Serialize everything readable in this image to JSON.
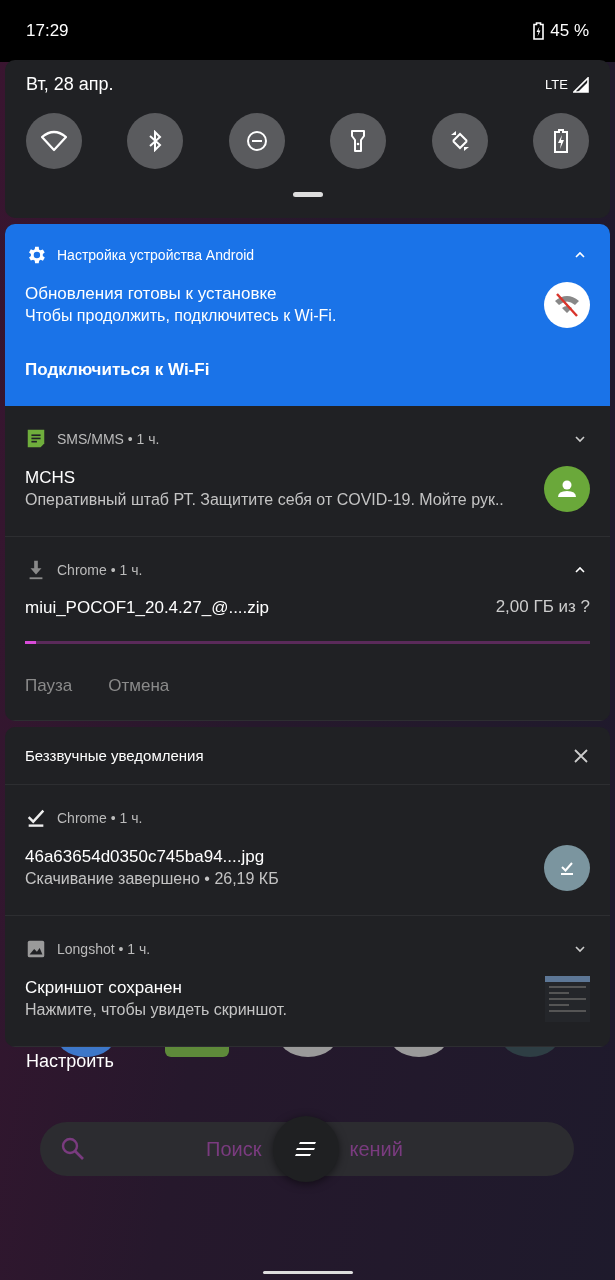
{
  "status_bar": {
    "time": "17:29",
    "battery": "45 %"
  },
  "quick_settings": {
    "date": "Вт, 28 апр.",
    "network": "LTE",
    "tiles": [
      {
        "kind": "wifi"
      },
      {
        "kind": "bluetooth"
      },
      {
        "kind": "dnd"
      },
      {
        "kind": "flashlight"
      },
      {
        "kind": "rotate"
      },
      {
        "kind": "battery_saver"
      }
    ]
  },
  "notifications": [
    {
      "kind": "system",
      "header": "Настройка устройства Android",
      "expanded": true,
      "title": "Обновления готовы к установке",
      "text": "Чтобы продолжить, подключитесь к Wi-Fi.",
      "actions": [
        "Подключиться к Wi-Fi"
      ]
    },
    {
      "kind": "message",
      "header": "SMS/MMS • 1 ч.",
      "expanded": false,
      "title": "MCHS",
      "text": "Оперативный штаб РТ. Защитите себя от COVID-19. Мойте рук.."
    },
    {
      "kind": "download",
      "header": "Chrome • 1 ч.",
      "expanded": true,
      "title": "miui_POCOF1_20.4.27_@....zip",
      "size": "2,00 ГБ из ?",
      "level": 0.02,
      "actions": [
        "Пауза",
        "Отмена"
      ]
    }
  ],
  "silent": {
    "header": "Беззвучные уведомления",
    "items": [
      {
        "kind": "download_done",
        "header": "Chrome • 1 ч.",
        "title": "46a63654d0350c745ba94....jpg",
        "text": "Скачивание завершено • 26,19 КБ"
      },
      {
        "kind": "screenshot",
        "header": "Longshot • 1 ч.",
        "expanded": false,
        "title": "Скриншот сохранен",
        "text": "Нажмите, чтобы увидеть скриншот."
      }
    ]
  },
  "home": {
    "customize": "Настроить",
    "search_start": "Поиск",
    "search_end": "кений"
  }
}
